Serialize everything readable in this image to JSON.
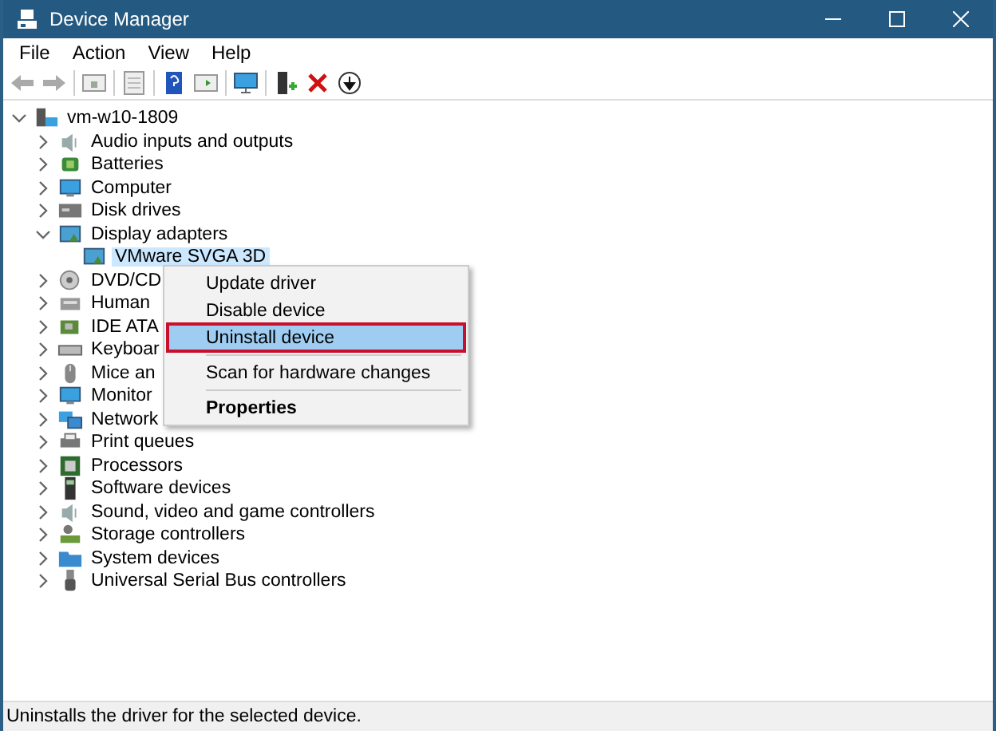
{
  "window": {
    "title": "Device Manager"
  },
  "menu_bar": [
    "File",
    "Action",
    "View",
    "Help"
  ],
  "tree": {
    "label": "vm-w10-1809",
    "expanded": true,
    "selected": false,
    "children": [
      {
        "label": "Audio inputs and outputs",
        "expanded": false,
        "selected": false
      },
      {
        "label": "Batteries",
        "expanded": false,
        "selected": false
      },
      {
        "label": "Computer",
        "expanded": false,
        "selected": false
      },
      {
        "label": "Disk drives",
        "expanded": false,
        "selected": false
      },
      {
        "label": "Display adapters",
        "expanded": true,
        "selected": false,
        "children": [
          {
            "label": "VMware SVGA 3D",
            "selected": true
          }
        ]
      },
      {
        "label": "DVD/CD",
        "expanded": false,
        "selected": false
      },
      {
        "label": "Human",
        "expanded": false,
        "selected": false
      },
      {
        "label": "IDE ATA",
        "expanded": false,
        "selected": false
      },
      {
        "label": "Keyboar",
        "expanded": false,
        "selected": false
      },
      {
        "label": "Mice an",
        "expanded": false,
        "selected": false
      },
      {
        "label": "Monitor",
        "expanded": false,
        "selected": false
      },
      {
        "label": "Network",
        "expanded": false,
        "selected": false
      },
      {
        "label": "Print queues",
        "expanded": false,
        "selected": false
      },
      {
        "label": "Processors",
        "expanded": false,
        "selected": false
      },
      {
        "label": "Software devices",
        "expanded": false,
        "selected": false
      },
      {
        "label": "Sound, video and game controllers",
        "expanded": false,
        "selected": false
      },
      {
        "label": "Storage controllers",
        "expanded": false,
        "selected": false
      },
      {
        "label": "System devices",
        "expanded": false,
        "selected": false
      },
      {
        "label": "Universal Serial Bus controllers",
        "expanded": false,
        "selected": false
      }
    ]
  },
  "context_menu": {
    "items": [
      {
        "kind": "item",
        "label": "Update driver",
        "selected": false
      },
      {
        "kind": "item",
        "label": "Disable device",
        "selected": false
      },
      {
        "kind": "item",
        "label": "Uninstall device",
        "selected": true
      },
      {
        "kind": "separator"
      },
      {
        "kind": "item",
        "label": "Scan for hardware changes",
        "selected": false
      },
      {
        "kind": "separator"
      },
      {
        "kind": "default",
        "label": "Properties",
        "selected": false
      }
    ]
  },
  "status_bar": "Uninstalls the driver for the selected device."
}
